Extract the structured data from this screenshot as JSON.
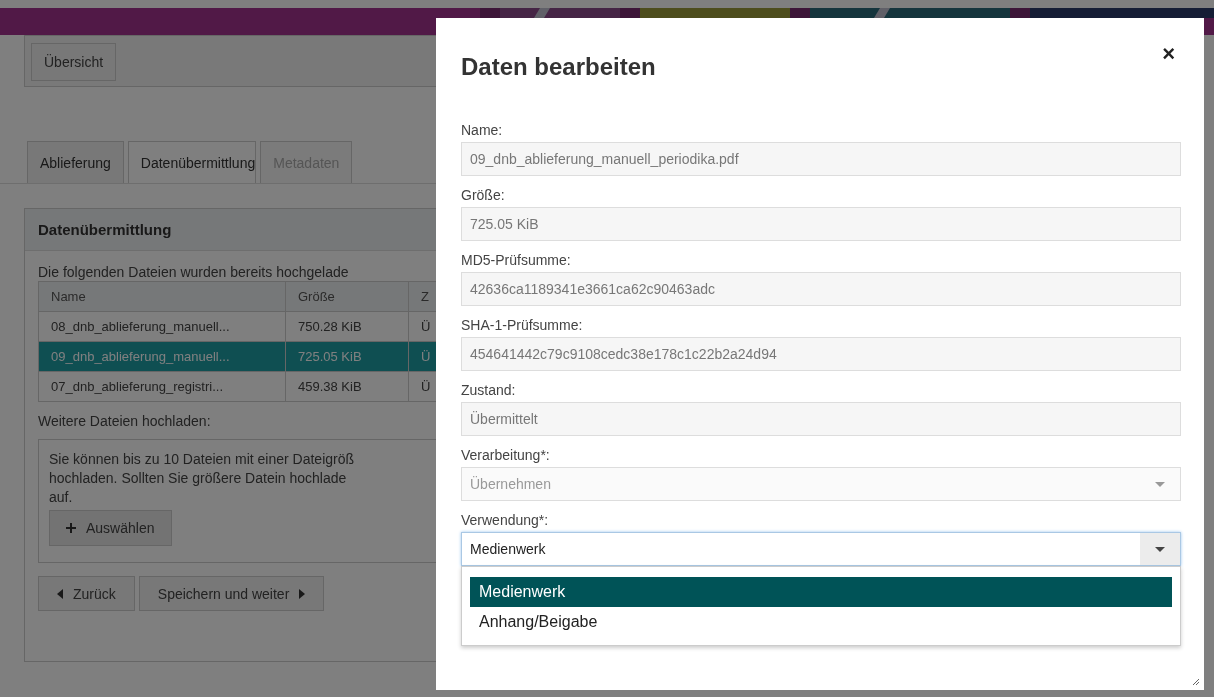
{
  "nav": {
    "overview_button": "Übersicht"
  },
  "tabs": [
    {
      "label": "Ablieferung",
      "selected": false,
      "disabled": false
    },
    {
      "label": "Datenübermittlung",
      "selected": true,
      "disabled": false
    },
    {
      "label": "Metadaten",
      "selected": false,
      "disabled": true
    }
  ],
  "panel": {
    "title": "Datenübermittlung",
    "intro": "Die folgenden Dateien wurden bereits hochgelade",
    "table": {
      "columns": [
        "Name",
        "Größe",
        "Z"
      ],
      "rows": [
        {
          "cells": [
            "08_dnb_ablieferung_manuell...",
            "750.28 KiB",
            "Ü"
          ],
          "selected": false
        },
        {
          "cells": [
            "09_dnb_ablieferung_manuell...",
            "725.05 KiB",
            "Ü"
          ],
          "selected": true
        },
        {
          "cells": [
            "07_dnb_ablieferung_registri...",
            "459.38 KiB",
            "Ü"
          ],
          "selected": false
        }
      ]
    },
    "upload_label": "Weitere Dateien hochladen:",
    "upload_text": "Sie können bis zu 10 Dateien mit einer Dateigröß\nhochladen. Sollten Sie größere Datein hochlade\nauf.",
    "choose_button": "Auswählen",
    "back_button": "Zurück",
    "save_button": "Speichern und weiter"
  },
  "dialog": {
    "title": "Daten bearbeiten",
    "close": "×",
    "fields": [
      {
        "kind": "text",
        "label": "Name:",
        "value": "09_dnb_ablieferung_manuell_periodika.pdf"
      },
      {
        "kind": "text",
        "label": "Größe:",
        "value": "725.05 KiB"
      },
      {
        "kind": "text",
        "label": "MD5-Prüfsumme:",
        "value": "42636ca1189341e3661ca62c90463adc"
      },
      {
        "kind": "text",
        "label": "SHA-1-Prüfsumme:",
        "value": "454641442c79c9108cedc38e178c1c22b2a24d94"
      },
      {
        "kind": "text",
        "label": "Zustand:",
        "value": "Übermittelt"
      },
      {
        "kind": "select",
        "label": "Verarbeitung*:",
        "value": "Übernehmen",
        "disabled": true,
        "expanded": false
      },
      {
        "kind": "select",
        "label": "Verwendung*:",
        "value": "Medienwerk",
        "disabled": false,
        "expanded": true,
        "options": [
          {
            "label": "Medienwerk",
            "selected": true
          },
          {
            "label": "Anhang/Beigabe",
            "selected": false
          }
        ]
      }
    ]
  }
}
